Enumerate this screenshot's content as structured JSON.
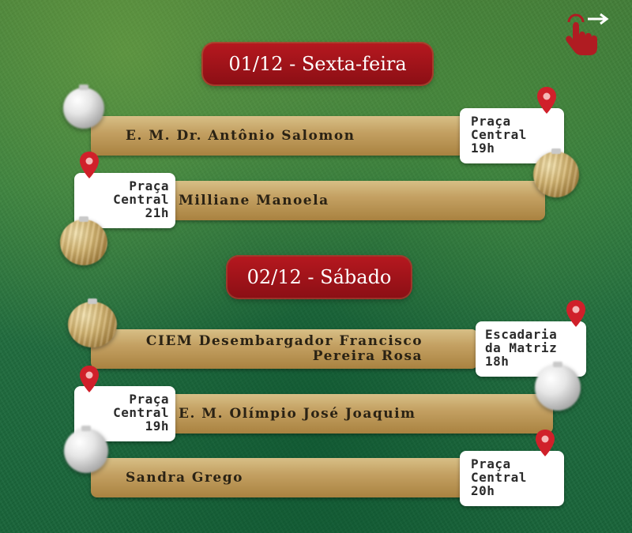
{
  "days": [
    {
      "header": "01/12 - Sexta-feira"
    },
    {
      "header": "02/12 - Sábado"
    }
  ],
  "events": [
    {
      "name": [
        "E. M. Dr. Antônio Salomon"
      ],
      "location": [
        "Praça",
        "Central",
        "19h"
      ]
    },
    {
      "name": [
        "Milliane Manoela"
      ],
      "location": [
        "Praça",
        "Central",
        "21h"
      ]
    },
    {
      "name": [
        "CIEM Desembargador Francisco",
        "Pereira Rosa"
      ],
      "location": [
        "Escadaria",
        "da Matriz",
        "18h"
      ]
    },
    {
      "name": [
        "E. M. Olímpio José Joaquim"
      ],
      "location": [
        "Praça",
        "Central",
        "19h"
      ]
    },
    {
      "name": [
        "Sandra Grego"
      ],
      "location": [
        "Praça",
        "Central",
        "20h"
      ]
    }
  ],
  "icons": {
    "swipe": "swipe-hand-icon",
    "pin": "map-pin-icon",
    "ornament": "christmas-ornament-icon"
  },
  "colors": {
    "header_red": "#a3121a",
    "bar_gold": "#c4a163",
    "pin_red": "#d0202a",
    "background_green": "#2e7a3e"
  }
}
